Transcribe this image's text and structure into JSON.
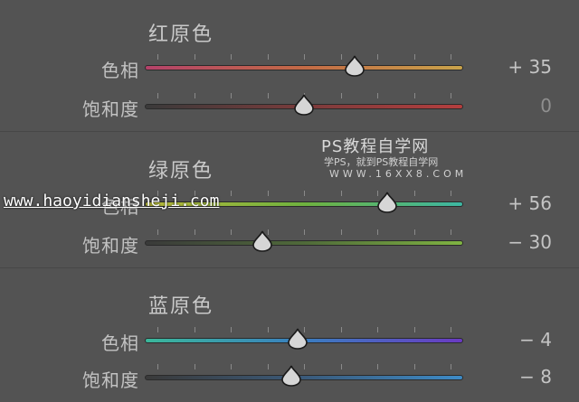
{
  "sections": [
    {
      "title": "红原色",
      "rows": [
        {
          "label": "色相",
          "value": "+ 35",
          "position": 0.66,
          "gradient": [
            "#b4426a",
            "#c36a45",
            "#c9a34a"
          ]
        },
        {
          "label": "饱和度",
          "value": "0",
          "position": 0.5,
          "gradient": [
            "#3a3a3a",
            "#7a3b3b",
            "#b53e3e"
          ]
        }
      ]
    },
    {
      "title": "绿原色",
      "rows": [
        {
          "label": "色相",
          "value": "+ 56",
          "position": 0.76,
          "gradient": [
            "#b8b83a",
            "#6fb23f",
            "#3db7a3"
          ]
        },
        {
          "label": "饱和度",
          "value": "− 30",
          "position": 0.37,
          "gradient": [
            "#3a3a3a",
            "#4f6a3a",
            "#7fb342"
          ]
        }
      ]
    },
    {
      "title": "蓝原色",
      "rows": [
        {
          "label": "色相",
          "value": "− 4",
          "position": 0.48,
          "gradient": [
            "#3ab79a",
            "#3a7ec0",
            "#6a3ac2"
          ]
        },
        {
          "label": "饱和度",
          "value": "− 8",
          "position": 0.46,
          "gradient": [
            "#3a3a3a",
            "#3a5a7a",
            "#3d8bc7"
          ]
        }
      ]
    }
  ],
  "watermark": {
    "site_cn": "PS教程自学网",
    "tagline": "学PS，就到PS教程自学网",
    "url_spaced": "WWW.16XX8.COM",
    "url_overlay": "www.haoyidiansheji.com"
  },
  "colors": {
    "background": "#535353",
    "thumb": "#d6d6d6",
    "text": "#c2c2c2"
  }
}
